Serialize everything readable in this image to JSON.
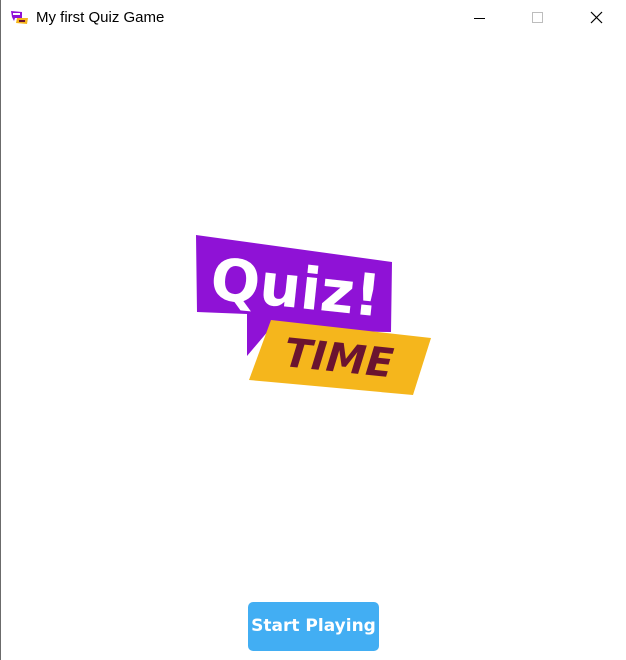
{
  "window": {
    "title": "My first Quiz Game",
    "controls": {
      "minimize_icon": "minimize-icon",
      "maximize_icon": "maximize-icon",
      "close_icon": "close-icon"
    }
  },
  "logo": {
    "word_top": "Quiz!",
    "word_bottom": "TIME",
    "colors": {
      "purple": "#8f12d6",
      "yellow": "#f5b61c",
      "dark_red": "#6a1430",
      "white": "#ffffff"
    }
  },
  "start_button": {
    "label": "Start Playing",
    "color": "#42aef3"
  }
}
